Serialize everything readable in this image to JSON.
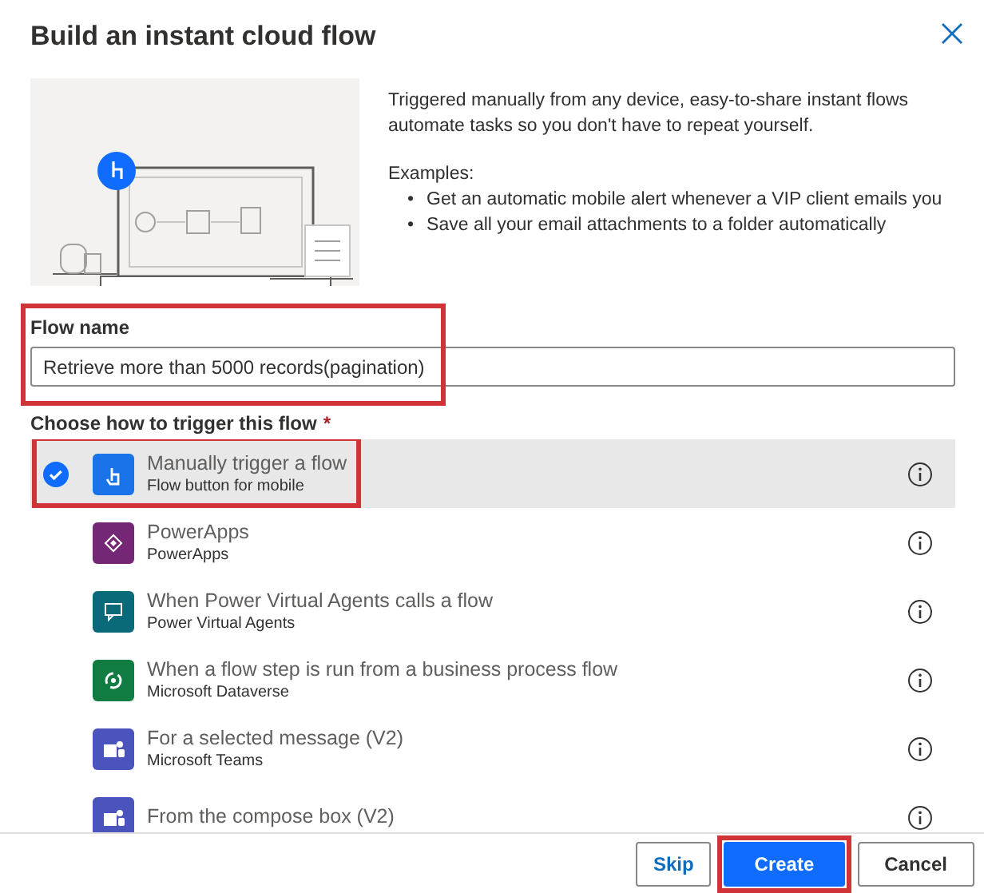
{
  "dialog": {
    "title": "Build an instant cloud flow"
  },
  "intro": {
    "description": "Triggered manually from any device, easy-to-share instant flows automate tasks so you don't have to repeat yourself.",
    "examples_label": "Examples:",
    "examples": [
      {
        "bullet": "•",
        "text": "Get an automatic mobile alert whenever a VIP client emails you"
      },
      {
        "bullet": "•",
        "text": "Save all your email attachments to a folder automatically"
      }
    ]
  },
  "flow_name": {
    "label": "Flow name",
    "value": "Retrieve more than 5000 records(pagination)",
    "highlighted": true
  },
  "trigger_label": {
    "text": "Choose how to trigger this flow",
    "required_mark": "*"
  },
  "triggers": [
    {
      "title": "Manually trigger a flow",
      "subtitle": "Flow button for mobile",
      "kind": "hand",
      "color": "#1a73e8",
      "selected": true,
      "highlighted": true
    },
    {
      "title": "PowerApps",
      "subtitle": "PowerApps",
      "kind": "diamond",
      "color": "#742774",
      "selected": false,
      "highlighted": false
    },
    {
      "title": "When Power Virtual Agents calls a flow",
      "subtitle": "Power Virtual Agents",
      "kind": "chat",
      "color": "#0b6a7a",
      "selected": false,
      "highlighted": false
    },
    {
      "title": "When a flow step is run from a business process flow",
      "subtitle": "Microsoft Dataverse",
      "kind": "swirl",
      "color": "#107c41",
      "selected": false,
      "highlighted": false
    },
    {
      "title": "For a selected message (V2)",
      "subtitle": "Microsoft Teams",
      "kind": "teams",
      "color": "#4b53bc",
      "selected": false,
      "highlighted": false
    },
    {
      "title": "From the compose box (V2)",
      "kind": "teams",
      "color": "#4b53bc",
      "selected": false,
      "highlighted": false
    }
  ],
  "buttons": [
    {
      "label": "Skip",
      "kind": "secondary",
      "highlighted": false
    },
    {
      "label": "Create",
      "kind": "primary",
      "highlighted": true
    },
    {
      "label": "Cancel",
      "kind": "default",
      "highlighted": false
    }
  ]
}
